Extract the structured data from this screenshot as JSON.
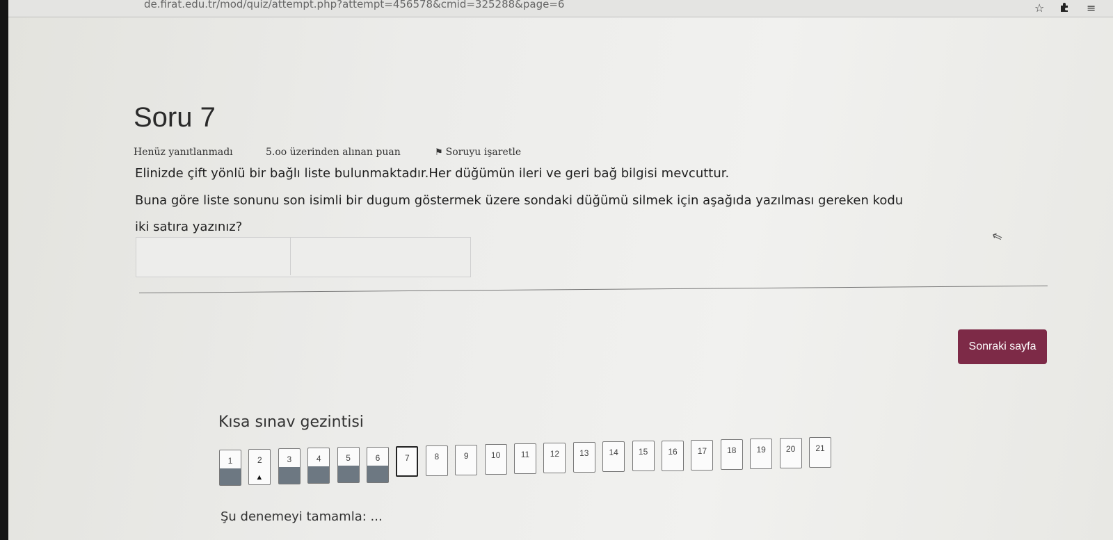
{
  "browser": {
    "url": "de.firat.edu.tr/mod/quiz/attempt.php?attempt=456578&cmid=325288&page=6",
    "star_icon": "☆",
    "extension_icon": "puzzle-icon",
    "menu_icon": "≡"
  },
  "question": {
    "title": "Soru 7",
    "status": "Henüz yanıtlanmadı",
    "points": "5.oo üzerinden alınan puan",
    "flag_label": "Soruyu işaretle",
    "text_line1": "Elinizde çift yönlü bir bağlı liste bulunmaktadır.Her düğümün ileri ve geri bağ bilgisi mevcuttur.",
    "text_line2": "Buna göre liste sonunu son isimli bir dugum göstermek üzere sondaki düğümü silmek için aşağıda yazılması gereken kodu",
    "text_line3": "iki satıra yazınız?",
    "answer_line1": "",
    "answer_line2": ""
  },
  "next_button": "Sonraki sayfa",
  "navigation": {
    "title": "Kısa sınav gezintisi",
    "buttons": [
      {
        "label": "1",
        "state": "answered"
      },
      {
        "label": "2",
        "state": "notyet"
      },
      {
        "label": "3",
        "state": "answered"
      },
      {
        "label": "4",
        "state": "answered"
      },
      {
        "label": "5",
        "state": "answered"
      },
      {
        "label": "6",
        "state": "answered"
      },
      {
        "label": "7",
        "state": "current"
      },
      {
        "label": "8",
        "state": "unanswered"
      },
      {
        "label": "9",
        "state": "unanswered"
      },
      {
        "label": "10",
        "state": "unanswered"
      },
      {
        "label": "11",
        "state": "unanswered"
      },
      {
        "label": "12",
        "state": "unanswered"
      },
      {
        "label": "13",
        "state": "unanswered"
      },
      {
        "label": "14",
        "state": "unanswered"
      },
      {
        "label": "15",
        "state": "unanswered"
      },
      {
        "label": "16",
        "state": "unanswered"
      },
      {
        "label": "17",
        "state": "unanswered"
      },
      {
        "label": "18",
        "state": "unanswered"
      },
      {
        "label": "19",
        "state": "unanswered"
      },
      {
        "label": "20",
        "state": "unanswered"
      },
      {
        "label": "21",
        "state": "unanswered"
      }
    ],
    "finish_link": "Şu denemeyi tamamla: ..."
  },
  "colors": {
    "next_button": "#7d2a47",
    "answered_fill": "#6d7882"
  }
}
